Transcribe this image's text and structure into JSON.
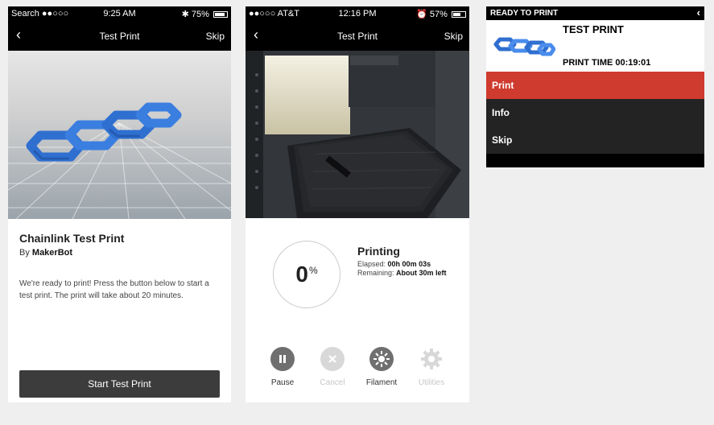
{
  "screen1": {
    "status": {
      "left": "Search ●●○○○",
      "time": "9:25 AM",
      "right": "75%"
    },
    "nav": {
      "back": "‹",
      "title": "Test Print",
      "skip": "Skip"
    },
    "title": "Chainlink Test Print",
    "by_prefix": "By",
    "author": "MakerBot",
    "description": "We're ready to print! Press the button below to start a test print. The print will take about 20 minutes.",
    "button": "Start Test Print"
  },
  "screen2": {
    "status": {
      "left": "●●○○○ AT&T",
      "time": "12:16 PM",
      "right": "57%"
    },
    "nav": {
      "back": "‹",
      "title": "Test Print",
      "skip": "Skip"
    },
    "progress": {
      "value": "0",
      "unit": "%",
      "fraction": 0
    },
    "status_text": "Printing",
    "elapsed_label": "Elapsed:",
    "elapsed_value": "00h 00m 03s",
    "remaining_label": "Remaining:",
    "remaining_value": "About 30m  left",
    "controls": [
      {
        "label": "Pause",
        "icon": "pause-icon",
        "enabled": true
      },
      {
        "label": "Cancel",
        "icon": "close-icon",
        "enabled": false
      },
      {
        "label": "Filament",
        "icon": "filament-icon",
        "enabled": true
      },
      {
        "label": "Utilities",
        "icon": "gear-icon",
        "enabled": false
      }
    ]
  },
  "panel": {
    "header": "READY TO PRINT",
    "back": "‹",
    "name": "TEST PRINT",
    "print_time": "PRINT TIME 00:19:01",
    "menu": [
      "Print",
      "Info",
      "Skip"
    ]
  },
  "colors": {
    "accent_red": "#cf3b2e",
    "button_dark": "#3c3c3c",
    "chain_blue": "#2f6fd0"
  }
}
